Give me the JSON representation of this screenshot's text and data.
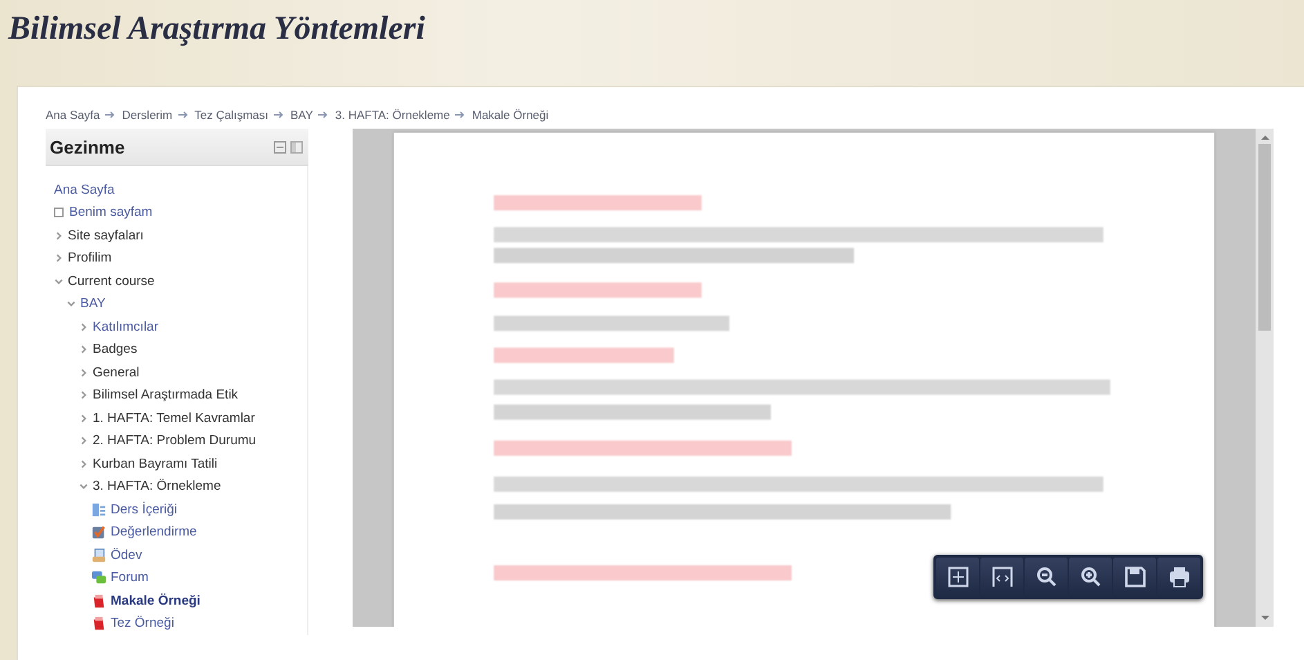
{
  "title": "Bilimsel Araştırma Yöntemleri",
  "breadcrumb": [
    "Ana Sayfa",
    "Derslerim",
    "Tez Çalışması",
    "BAY",
    "3. HAFTA: Örnekleme",
    "Makale Örneği"
  ],
  "navigation": {
    "title": "Gezinme",
    "items": [
      {
        "label": "Ana Sayfa",
        "kind": "root"
      },
      {
        "label": "Benim sayfam",
        "kind": "bullet"
      },
      {
        "label": "Site sayfaları",
        "kind": "branch",
        "linked": false,
        "expanded": false
      },
      {
        "label": "Profilim",
        "kind": "branch",
        "linked": false,
        "expanded": false
      },
      {
        "label": "Current course",
        "kind": "branch",
        "linked": false,
        "expanded": true,
        "children": [
          {
            "label": "BAY",
            "kind": "branch",
            "linked": true,
            "expanded": true,
            "children": [
              {
                "label": "Katılımcılar",
                "kind": "branch",
                "linked": true,
                "expanded": false
              },
              {
                "label": "Badges",
                "kind": "branch",
                "linked": false,
                "expanded": false
              },
              {
                "label": "General",
                "kind": "branch",
                "linked": false,
                "expanded": false
              },
              {
                "label": "Bilimsel Araştırmada Etik",
                "kind": "branch",
                "linked": false,
                "expanded": false
              },
              {
                "label": "1. HAFTA: Temel Kavramlar",
                "kind": "branch",
                "linked": false,
                "expanded": false
              },
              {
                "label": "2. HAFTA: Problem Durumu",
                "kind": "branch",
                "linked": false,
                "expanded": false
              },
              {
                "label": "Kurban Bayramı Tatili",
                "kind": "branch",
                "linked": false,
                "expanded": false
              },
              {
                "label": "3. HAFTA: Örnekleme",
                "kind": "branch",
                "linked": false,
                "expanded": true,
                "children": [
                  {
                    "label": "Ders İçeriği",
                    "kind": "page",
                    "selected": false
                  },
                  {
                    "label": "Değerlendirme",
                    "kind": "quiz",
                    "selected": false
                  },
                  {
                    "label": "Ödev",
                    "kind": "assignment",
                    "selected": false
                  },
                  {
                    "label": "Forum",
                    "kind": "forum",
                    "selected": false
                  },
                  {
                    "label": "Makale Örneği",
                    "kind": "file",
                    "selected": true
                  },
                  {
                    "label": "Tez Örneği",
                    "kind": "file",
                    "selected": false
                  }
                ]
              }
            ]
          }
        ]
      }
    ]
  }
}
